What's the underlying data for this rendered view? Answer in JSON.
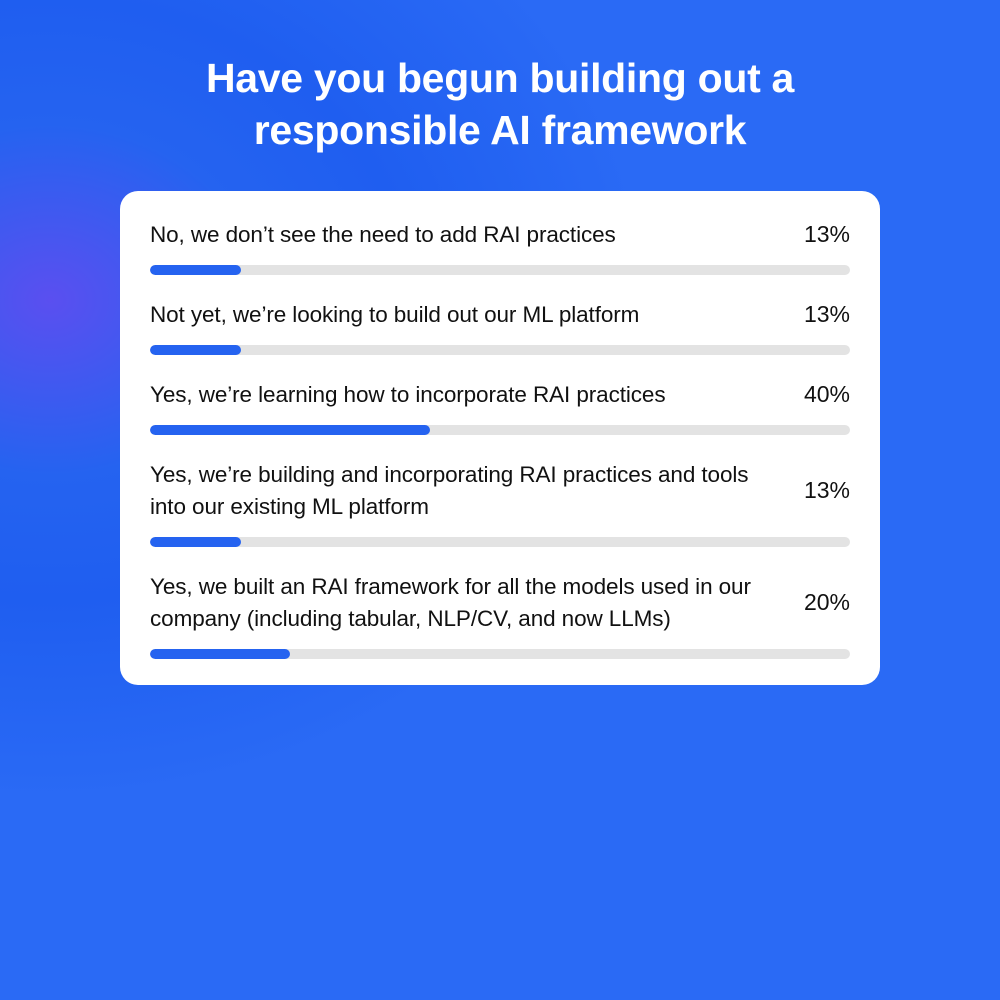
{
  "title": "Have you begun building out a responsible AI framework",
  "accent_color": "#2563f0",
  "track_color": "#e3e3e3",
  "chart_data": {
    "type": "bar",
    "title": "Have you begun building out a responsible AI framework",
    "xlabel": "",
    "ylabel": "",
    "ylim": [
      0,
      100
    ],
    "categories": [
      "No, we don’t see the need to add RAI practices",
      "Not yet, we’re looking to build out our ML platform",
      "Yes, we’re learning how to incorporate RAI practices",
      "Yes, we’re building and incorporating RAI practices and tools into our existing ML platform",
      "Yes, we built an RAI framework for all the models used in our company (including tabular, NLP/CV, and now LLMs)"
    ],
    "values": [
      13,
      13,
      40,
      13,
      20
    ],
    "value_labels": [
      "13%",
      "13%",
      "40%",
      "13%",
      "20%"
    ]
  }
}
